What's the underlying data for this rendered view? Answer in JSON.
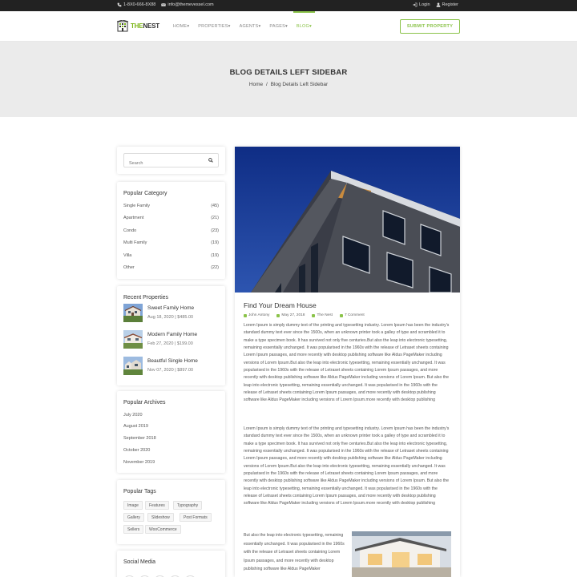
{
  "topbar": {
    "phone": "1-8X0-666-8X88",
    "email": "info@themevessel.com",
    "login": "Login",
    "register": "Register"
  },
  "logo": {
    "prefix": "THE",
    "word": "NEST"
  },
  "menu": {
    "items": [
      "HOME",
      "PROPERTIES",
      "AGENTS",
      "PAGES",
      "BLOG"
    ],
    "active": "BLOG"
  },
  "submit_label": "SUBMIT PROPERTY",
  "banner": {
    "title": "BLOG DETAILS LEFT SIDEBAR",
    "crumb_home": "Home",
    "crumb_sep": "/",
    "crumb_current": "Blog Details Left Sidebar"
  },
  "search": {
    "placeholder": "Search"
  },
  "popular_category": {
    "title": "Popular Category",
    "items": [
      {
        "name": "Single Family",
        "count": "(45)"
      },
      {
        "name": "Apartment",
        "count": "(21)"
      },
      {
        "name": "Condo",
        "count": "(23)"
      },
      {
        "name": "Multi Family",
        "count": "(19)"
      },
      {
        "name": "Villa",
        "count": "(19)"
      },
      {
        "name": "Other",
        "count": "(22)"
      }
    ]
  },
  "recent_properties": {
    "title": "Recent Properties",
    "items": [
      {
        "title": "Sweet Family Home",
        "meta": "Aug 18, 2020 | $485.00"
      },
      {
        "title": "Modern Family Home",
        "meta": "Feb 27, 2020 | $199.00"
      },
      {
        "title": "Beautful Single Home",
        "meta": "Nov 07, 2020 | $897.00"
      }
    ]
  },
  "archives": {
    "title": "Popular Archives",
    "items": [
      "July 2020",
      "August 2019",
      "September 2018",
      "October 2020",
      "November 2019"
    ]
  },
  "tags": {
    "title": "Popular Tags",
    "items": [
      "Image",
      "Features",
      "Typography",
      "Gallery",
      "Slideshow",
      "Post Formats",
      "Sellers",
      "WooCommerce"
    ]
  },
  "social": {
    "title": "Social Media",
    "icons": [
      "f",
      "t",
      "in",
      "G+",
      "p"
    ],
    "icon_names": [
      "facebook-icon",
      "twitter-icon",
      "linkedin-icon",
      "google-plus-icon",
      "pinterest-icon"
    ]
  },
  "post": {
    "title": "Find Your Dream House",
    "author": "John Antony",
    "date": "May 27, 2018",
    "category": "The Nest",
    "comments": "7 Comment",
    "para1": "Lorem Ipsum is simply dummy text of the printing and typesetting industry. Lorem Ipsum has been the industry's standard dummy text ever since the 1500s, when an unknown printer took a galley of type and scrambled it to make a type specimen book. It has survived not only five centuries.But also the leap into electronic typesetting, remaining essentially unchanged. It was popularised in the 1960s with the release of Letraset sheets containing Lorem Ipsum passages, and more recently with desktop publishing software like Aldus PageMaker including versions of Lorem Ipsum.But also the leap into electronic typesetting, remaining essentially unchanged. It was popularised in the 1960s with the release of Letraset sheets containing Lorem Ipsum passages, and more recently with desktop publishing software like Aldus PageMaker including versions of Lorem Ipsum. But also the leap into electronic typesetting, remaining essentially unchanged. It was popularised in the 1960s with the release of Letraset sheets containing Lorem Ipsum passages, and more recently with desktop publishing software like Aldus PageMaker including versions of Lorem Ipsum.more recently with desktop publishing",
    "para2": "Lorem Ipsum is simply dummy text of the printing and typesetting industry. Lorem Ipsum has been the industry's standard dummy text ever since the 1500s, when an unknown printer took a galley of type and scrambled it to make a type specimen book. It has survived not only five centuries.But also the leap into electronic typesetting, remaining essentially unchanged. It was popularised in the 1960s with the release of Letraset sheets containing Lorem Ipsum passages, and more recently with desktop publishing software like Aldus PageMaker including versions of Lorem Ipsum.But also the leap into electronic typesetting, remaining essentially unchanged. It was popularised in the 1960s with the release of Letraset sheets containing Lorem Ipsum passages, and more recently with desktop publishing software like Aldus PageMaker including versions of Lorem Ipsum. But also the leap into electronic typesetting, remaining essentially unchanged. It was popularised in the 1960s with the release of Letraset sheets containing Lorem Ipsum passages, and more recently with desktop publishing software like Aldus PageMaker including versions of Lorem Ipsum.more recently with desktop publishing",
    "para3": "But also the leap into electronic typesetting, remaining essentially unchanged. It was popularised in the 1960s with the release of Letraset sheets containing Lorem Ipsum passages, and more recently with desktop publishing software like Aldus PageMaker"
  },
  "colors": {
    "accent": "#8bc34a",
    "topbar": "#222222",
    "banner": "#ebebeb"
  }
}
